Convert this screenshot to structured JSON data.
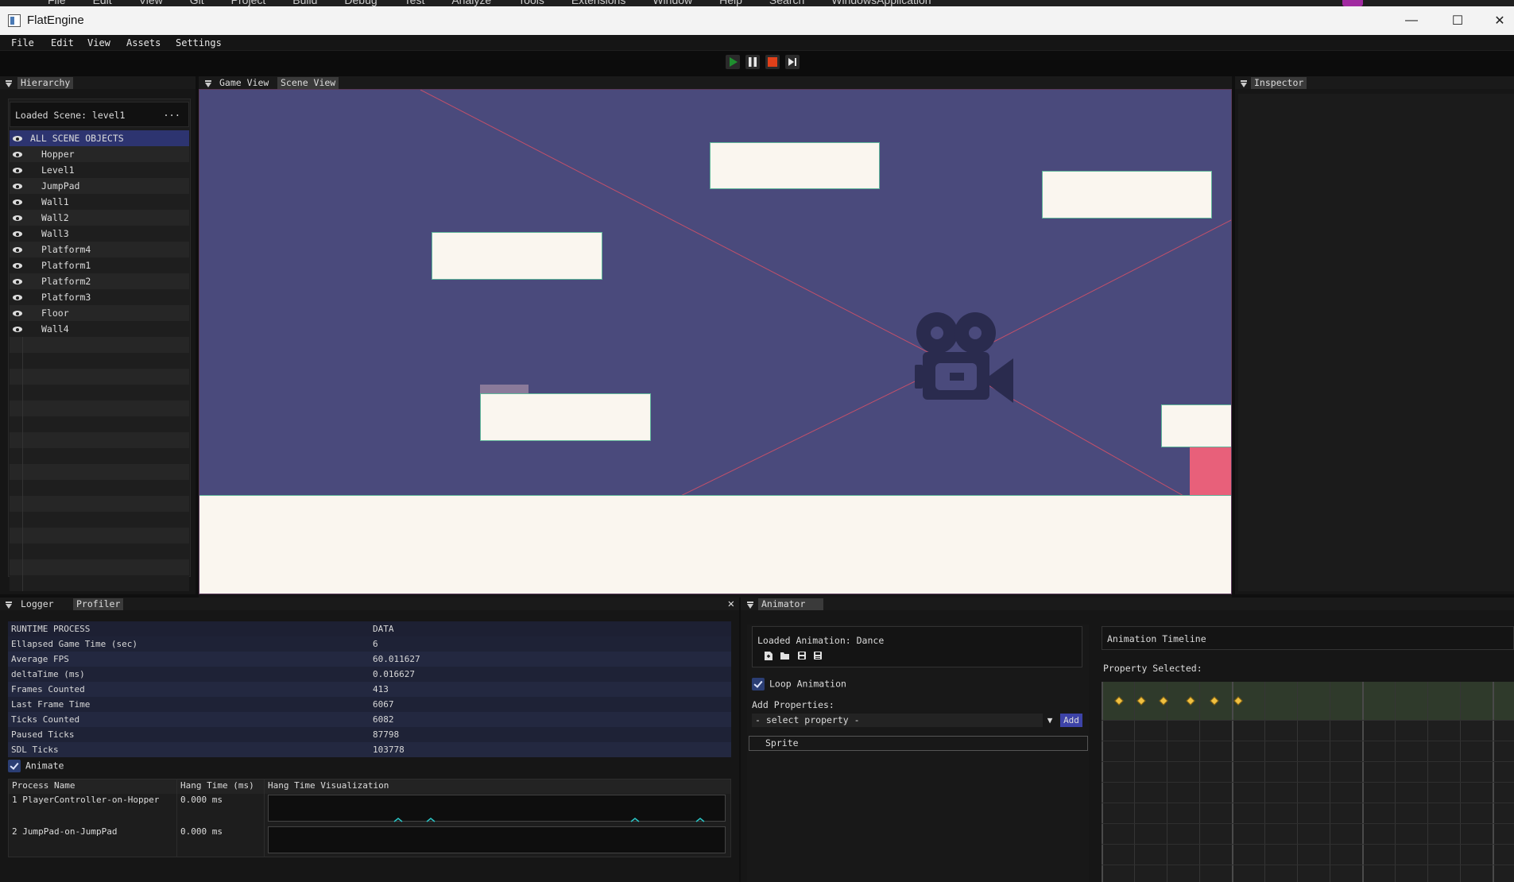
{
  "vs_menu": [
    "File",
    "Edit",
    "View",
    "Git",
    "Project",
    "Build",
    "Debug",
    "Test",
    "Analyze",
    "Tools",
    "Extensions",
    "Window",
    "Help",
    "Search",
    "WindowsApplication"
  ],
  "window": {
    "title": "FlatEngine",
    "minimize": "—",
    "maximize": "☐",
    "close": "✕"
  },
  "menubar": [
    "File",
    "Edit",
    "View",
    "Assets",
    "Settings"
  ],
  "toolbar": {
    "play_color": "#1f8f2f",
    "pause_color": "#e0e0e0",
    "stop_color": "#e0401a"
  },
  "hierarchy": {
    "tab": "Hierarchy",
    "loaded_scene": "Loaded Scene: level1",
    "menu_dots": "...",
    "all_label": "ALL SCENE OBJECTS",
    "objects": [
      "Hopper",
      "Level1",
      "JumpPad",
      "Wall1",
      "Wall2",
      "Wall3",
      "Platform4",
      "Platform1",
      "Platform2",
      "Platform3",
      "Floor",
      "Wall4"
    ]
  },
  "views": {
    "tabs": [
      "Game View",
      "Scene View"
    ],
    "active": "Scene View",
    "scene_bg": "#4a4a7c"
  },
  "inspector": {
    "tab": "Inspector"
  },
  "profiler": {
    "tabs": [
      "Logger",
      "Profiler"
    ],
    "close": "✕",
    "runtime_header": [
      "RUNTIME PROCESS",
      "DATA"
    ],
    "runtime_rows": [
      [
        "Ellapsed Game Time (sec)",
        "6"
      ],
      [
        "Average FPS",
        "60.011627"
      ],
      [
        "deltaTime (ms)",
        "0.016627"
      ],
      [
        "Frames Counted",
        "413"
      ],
      [
        "Last Frame Time",
        "6067"
      ],
      [
        "Ticks Counted",
        "6082"
      ],
      [
        "Paused Ticks",
        "87798"
      ],
      [
        "SDL Ticks",
        "103778"
      ]
    ],
    "animate_label": "Animate",
    "process_header": [
      "Process Name",
      "Hang Time (ms)",
      "Hang Time Visualization"
    ],
    "processes": [
      [
        "1 PlayerController-on-Hopper",
        "0.000 ms"
      ],
      [
        "2 JumpPad-on-JumpPad",
        "0.000 ms"
      ]
    ]
  },
  "animator": {
    "tab": "Animator",
    "loaded_animation": "Loaded Animation: Dance",
    "icons": [
      "new-file-icon",
      "open-folder-icon",
      "save-icon",
      "save-as-icon"
    ],
    "loop_label": "Loop Animation",
    "add_properties_label": "Add Properties:",
    "select_placeholder": "- select property -",
    "add_button": "Add",
    "property": "Sprite",
    "timeline_title": "Animation Timeline",
    "property_selected_label": "Property Selected:"
  }
}
